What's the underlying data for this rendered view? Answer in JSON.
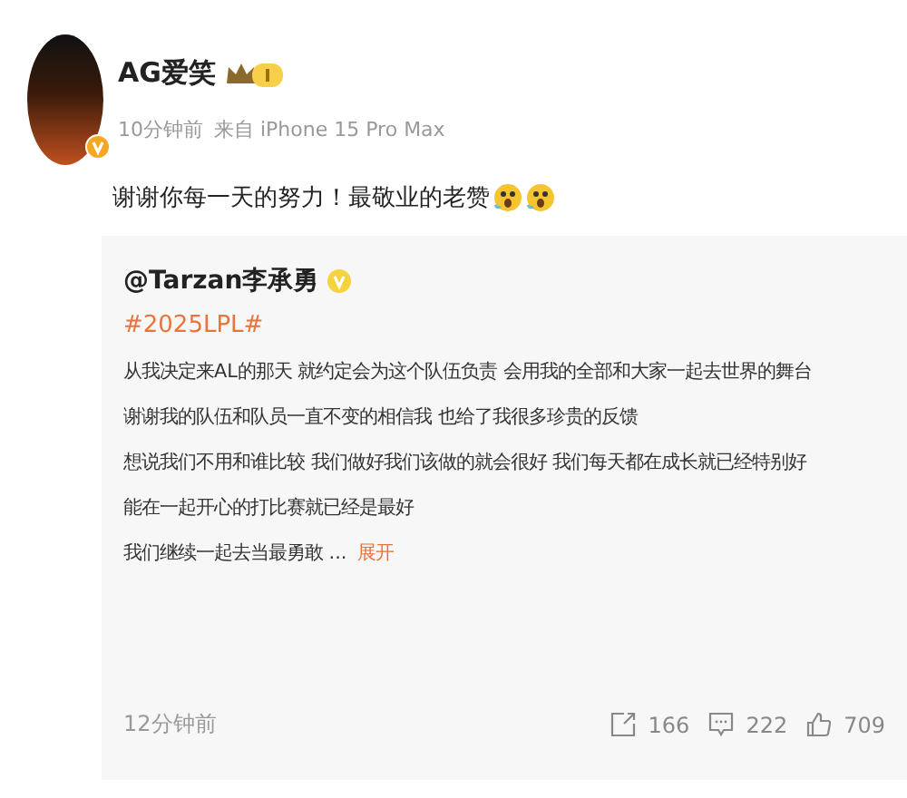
{
  "post": {
    "author": "AG爱笑",
    "time": "10分钟前",
    "source": "来自 iPhone 15 Pro Max",
    "text": "谢谢你每一天的努力！最敬业的老赞",
    "emojis": [
      {
        "kind": "scared"
      },
      {
        "kind": "scared"
      }
    ]
  },
  "repost": {
    "author": "@Tarzan李承勇",
    "hashtag": "#2025LPL#",
    "lines": [
      "从我决定来AL的那天 就约定会为这个队伍负责 会用我的全部和大家一起去世界的舞台",
      "谢谢我的队伍和队员一直不变的相信我 也给了我很多珍贵的反馈",
      "想说我们不用和谁比较 我们做好我们该做的就会很好 我们每天都在成长就已经特别好",
      "能在一起开心的打比赛就已经是最好",
      "我们继续一起去当最勇敢 ..."
    ],
    "expand": "展开",
    "time": "12分钟前",
    "actions": [
      {
        "kind": "share",
        "count": "166"
      },
      {
        "kind": "comment",
        "count": "222"
      },
      {
        "kind": "like",
        "count": "709"
      }
    ]
  }
}
